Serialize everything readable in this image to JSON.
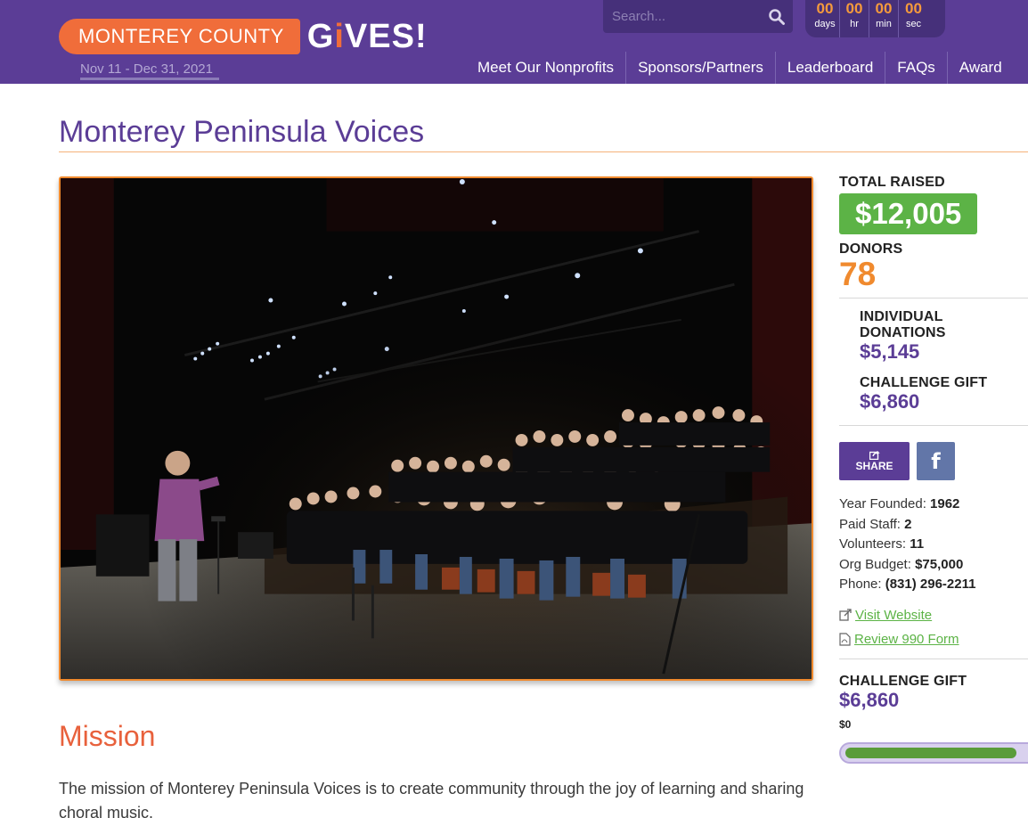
{
  "header": {
    "logo_county": "MONTEREY COUNTY",
    "logo_gives": "GiVES!",
    "dates": "Nov 11 - Dec 31, 2021",
    "search_placeholder": "Search...",
    "countdown": [
      {
        "value": "00",
        "unit": "days"
      },
      {
        "value": "00",
        "unit": "hr"
      },
      {
        "value": "00",
        "unit": "min"
      },
      {
        "value": "00",
        "unit": "sec"
      }
    ],
    "nav": [
      "Meet Our Nonprofits",
      "Sponsors/Partners",
      "Leaderboard",
      "FAQs",
      "Award"
    ]
  },
  "page": {
    "title": "Monterey Peninsula Voices",
    "mission_heading": "Mission",
    "mission_text": "The mission of Monterey Peninsula Voices is to create community through the joy of learning and sharing choral music."
  },
  "sidebar": {
    "total_raised_label": "TOTAL RAISED",
    "total_raised": "$12,005",
    "donors_label": "DONORS",
    "donors": "78",
    "individual_label": "INDIVIDUAL DONATIONS",
    "individual": "$5,145",
    "challenge_label": "CHALLENGE GIFT",
    "challenge": "$6,860",
    "share_label": "SHARE",
    "facts": [
      {
        "label": "Year Founded:",
        "value": "1962"
      },
      {
        "label": "Paid Staff:",
        "value": "2"
      },
      {
        "label": "Volunteers:",
        "value": "11"
      },
      {
        "label": "Org Budget:",
        "value": "$75,000"
      },
      {
        "label": "Phone:",
        "value": "(831) 296-2211"
      }
    ],
    "visit_website": "Visit Website",
    "review_990": "Review 990 Form",
    "challenge2_label": "CHALLENGE GIFT",
    "challenge2": "$6,860",
    "challenge2_sub": "$0",
    "challenge_progress_fraction": 0.96
  },
  "colors": {
    "brand_purple": "#5b3d96",
    "brand_orange": "#f06d3a",
    "green": "#5cb346"
  }
}
